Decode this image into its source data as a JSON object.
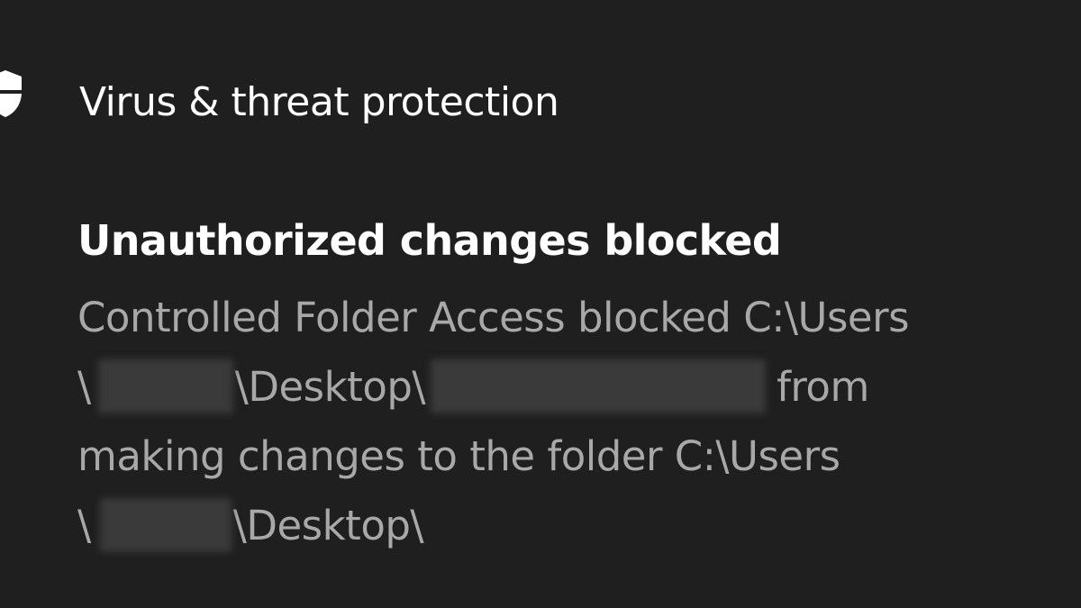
{
  "notification": {
    "app_name": "Virus & threat protection",
    "app_icon": "shield-icon",
    "title": "Unauthorized changes blocked",
    "body": {
      "line1": "Controlled Folder Access blocked C:\\Users",
      "line2_prefix": "\\",
      "line2_mid": "\\Desktop\\",
      "line2_suffix": "from",
      "line3": "making changes to the folder C:\\Users",
      "line4_prefix": "\\",
      "line4_suffix": "\\Desktop\\"
    }
  },
  "colors": {
    "background": "#1f1f1f",
    "title_text": "#ffffff",
    "body_text": "#a8a8a8"
  }
}
